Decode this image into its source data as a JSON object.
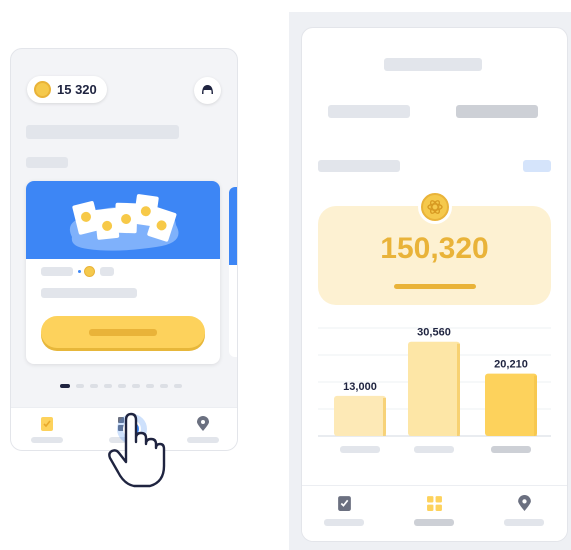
{
  "left_screen": {
    "coin_balance": "15 320",
    "nav": {
      "items": [
        {
          "icon": "checklist-icon",
          "active": true
        },
        {
          "icon": "grid-icon",
          "active": false,
          "tapped": true
        },
        {
          "icon": "location-pin-icon",
          "active": false
        }
      ]
    },
    "pagination": {
      "dots": 9,
      "active_index": 0
    }
  },
  "right_screen": {
    "total_coins": "150,320",
    "nav": {
      "items": [
        {
          "icon": "checklist-icon",
          "active": false
        },
        {
          "icon": "grid-icon",
          "active": true
        },
        {
          "icon": "location-pin-icon",
          "active": false
        }
      ]
    }
  },
  "chart_data": {
    "type": "bar",
    "values": [
      13000,
      30560,
      20210
    ],
    "value_labels": [
      "13,000",
      "30,560",
      "20,210"
    ],
    "ylim": [
      0,
      35000
    ],
    "grid": true,
    "colors": [
      "#fde9b6",
      "#fde6a6",
      "#fdd25c"
    ]
  },
  "colors": {
    "accent_yellow": "#fdd25c",
    "gold": "#e9b339",
    "blue": "#3d86f5",
    "navy_text": "#1f2440"
  }
}
